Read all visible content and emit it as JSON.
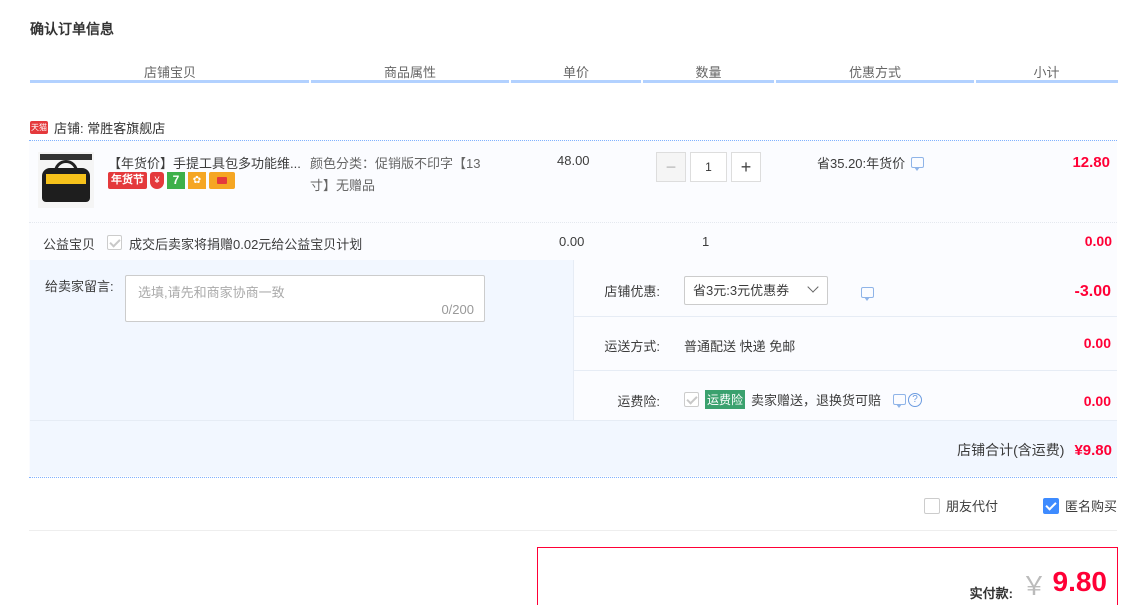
{
  "page_title": "确认订单信息",
  "columns": [
    "店铺宝贝",
    "商品属性",
    "单价",
    "数量",
    "优惠方式",
    "小计"
  ],
  "shop": {
    "badge": "天猫",
    "label": "店铺: 常胜客旗舰店"
  },
  "item": {
    "title": "【年货价】手提工具包多功能维...",
    "tag_nhj": "年货节",
    "attr_line1": "颜色分类：促销版不印字【13",
    "attr_line2": "寸】无赠品",
    "price": "48.00",
    "quantity": "1",
    "promo": "省35.20:年货价",
    "subtotal": "12.80"
  },
  "charity": {
    "label": "公益宝贝",
    "text": "成交后卖家将捐赠0.02元给公益宝贝计划",
    "price": "0.00",
    "quantity": "1",
    "subtotal": "0.00"
  },
  "memo": {
    "label": "给卖家留言:",
    "placeholder": "选填,请先和商家协商一致",
    "count": "0/200"
  },
  "shop_discount": {
    "label": "店铺优惠:",
    "selected": "省3元:3元优惠券",
    "amount": "-3.00"
  },
  "shipping": {
    "label": "运送方式:",
    "value": "普通配送 快递 免邮",
    "amount": "0.00"
  },
  "insurance": {
    "label": "运费险:",
    "tag": "运费险",
    "text": "卖家赠送，退换货可赔",
    "amount": "0.00"
  },
  "shop_total": {
    "label": "店铺合计(含运费)",
    "amount": "¥9.80"
  },
  "options": {
    "friend_pay": "朋友代付",
    "anonymous": "匿名购买"
  },
  "payment": {
    "label": "实付款:",
    "yen": "￥",
    "amount": "9.80"
  }
}
